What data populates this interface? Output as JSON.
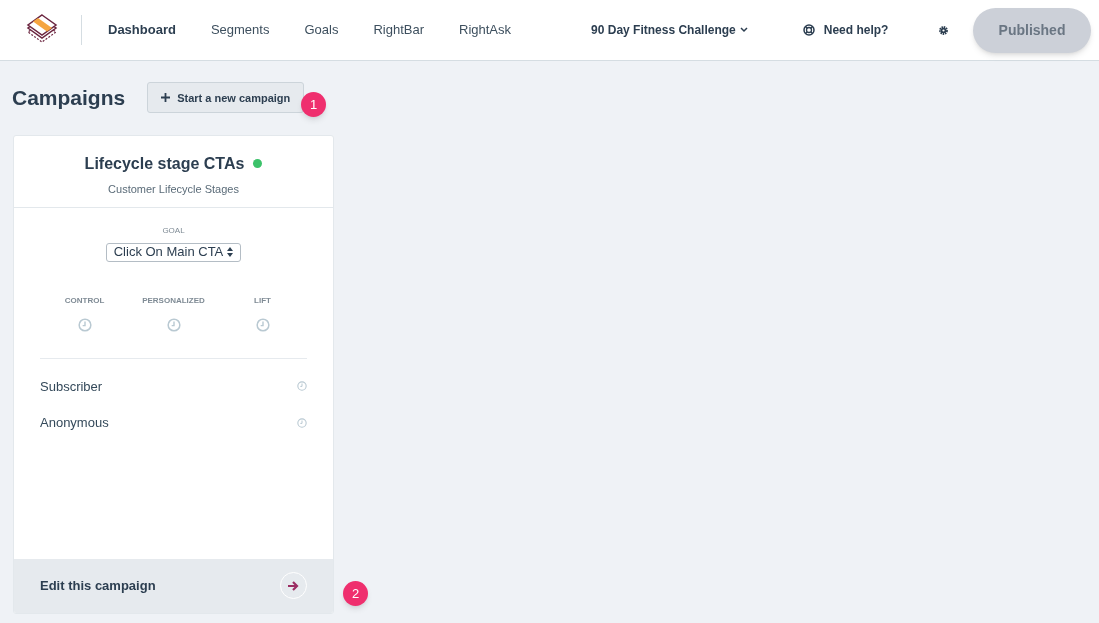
{
  "nav": [
    {
      "label": "Dashboard",
      "selected": true
    },
    {
      "label": "Segments",
      "selected": false
    },
    {
      "label": "Goals",
      "selected": false
    },
    {
      "label": "RightBar",
      "selected": false
    },
    {
      "label": "RightAsk",
      "selected": false
    }
  ],
  "project_menu": "90 Day Fitness Challenge",
  "help": "Need help?",
  "publish_button": "Published",
  "page_title": "Campaigns",
  "new_campaign_button": "Start a new campaign",
  "markers": [
    "1",
    "2"
  ],
  "campaign": {
    "title": "Lifecycle stage CTAs",
    "active": true,
    "subtitle": "Customer Lifecycle Stages",
    "goal_label": "GOAL",
    "goal": "Click On Main CTA",
    "metrics": [
      "CONTROL",
      "PERSONALIZED",
      "LIFT"
    ],
    "segments": [
      "Subscriber",
      "Anonymous"
    ],
    "edit_link": "Edit this campaign"
  }
}
